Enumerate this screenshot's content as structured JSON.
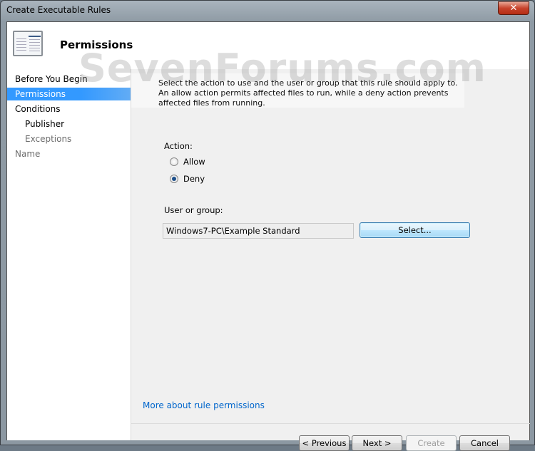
{
  "window": {
    "title": "Create Executable Rules",
    "close": "✕"
  },
  "header": {
    "title": "Permissions",
    "watermark": "SevenForums.com"
  },
  "sidebar": {
    "items": [
      {
        "label": "Before You Begin",
        "state": "normal"
      },
      {
        "label": "Permissions",
        "state": "selected"
      },
      {
        "label": "Conditions",
        "state": "normal"
      },
      {
        "label": "Publisher",
        "state": "normal"
      },
      {
        "label": "Exceptions",
        "state": "disabled"
      },
      {
        "label": "Name",
        "state": "disabled"
      }
    ]
  },
  "main": {
    "description": "Select the action to use and the user or group that this rule should apply to. An allow action permits affected files to run, while a deny action prevents affected files from running.",
    "action_label": "Action:",
    "options": [
      {
        "label": "Allow",
        "checked": false
      },
      {
        "label": "Deny",
        "checked": true
      }
    ],
    "user_label": "User or group:",
    "user_value": "Windows7-PC\\Example Standard",
    "select_button": "Select...",
    "link": "More about rule permissions"
  },
  "footer": {
    "previous": "< Previous",
    "next": "Next >",
    "create": "Create",
    "cancel": "Cancel"
  }
}
